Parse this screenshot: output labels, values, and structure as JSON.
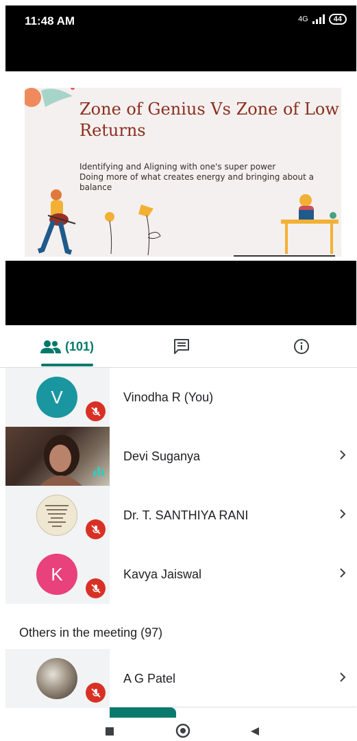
{
  "status_bar": {
    "time": "11:48 AM",
    "network": "4G",
    "battery": "44"
  },
  "slide": {
    "title": "Zone of Genius Vs Zone of Low Returns",
    "body_line1": "Identifying and Aligning with one's super power",
    "body_line2": "Doing more of what creates energy and bringing about a balance"
  },
  "tabs": {
    "people_count": "(101)",
    "active_color": "#00796b"
  },
  "participants": [
    {
      "name": "Vinodha R (You)",
      "avatar_letter": "V",
      "avatar_color": "#1a96a0",
      "muted": true
    },
    {
      "name": "Devi Suganya",
      "video": true,
      "speaking": true
    },
    {
      "name": "Dr. T. SANTHIYA RANI",
      "muted": true,
      "avatar_image": "photo-text"
    },
    {
      "name": "Kavya Jaiswal",
      "avatar_letter": "K",
      "avatar_color": "#e8417b",
      "muted": true
    }
  ],
  "others": {
    "title": "Others in the meeting (97)",
    "items": [
      {
        "name": "A G Patel",
        "muted": true,
        "avatar_image": "photo"
      }
    ]
  },
  "progress": 0.27,
  "colors": {
    "mute_red": "#d93025",
    "teal": "#00796b"
  }
}
